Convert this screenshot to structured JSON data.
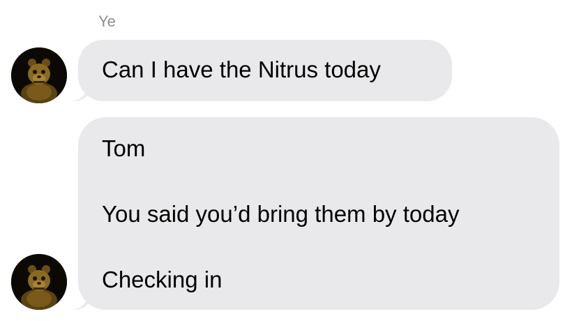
{
  "conversation": {
    "sender_name": "Ye",
    "messages": [
      {
        "lines": [
          "Can I have the Nitrus today"
        ]
      },
      {
        "lines": [
          "Tom",
          "You said you’d bring them by today",
          "Checking in"
        ]
      }
    ],
    "avatar_icon": "golden-animatronic-bear-avatar",
    "bubble_color": "#e9e9eb",
    "name_color": "#8e8e93"
  }
}
